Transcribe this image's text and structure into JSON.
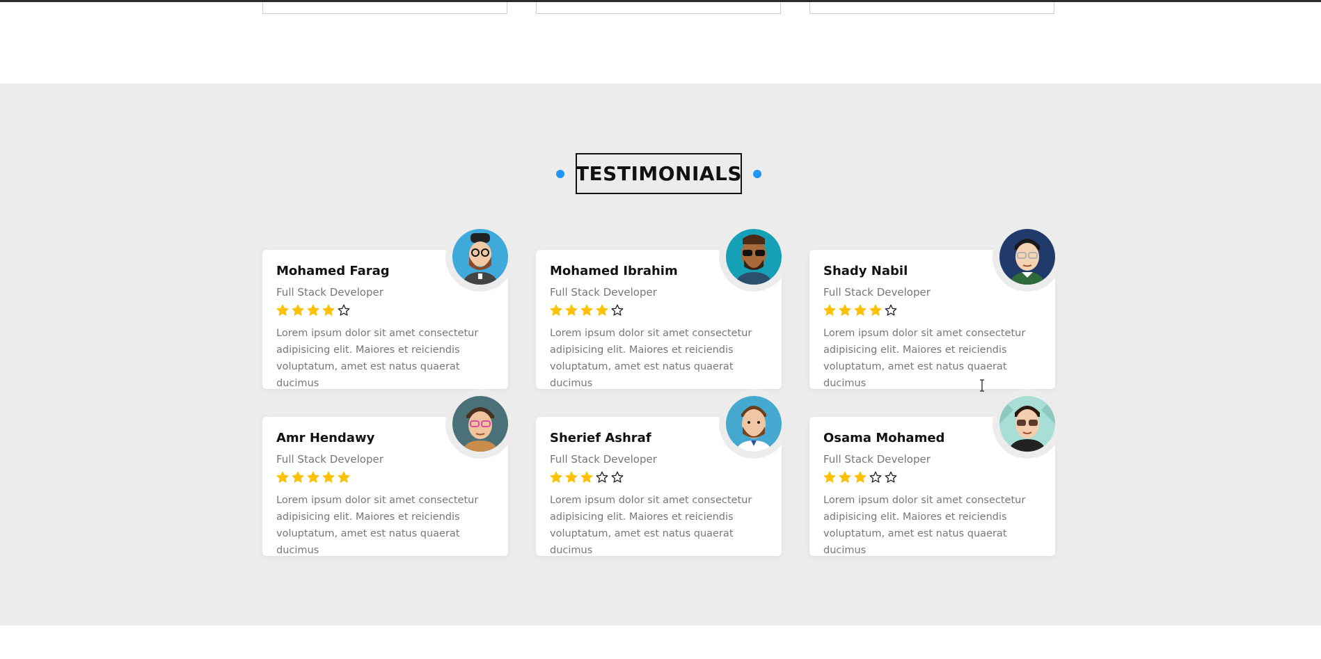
{
  "section": {
    "title": "TESTIMONIALS"
  },
  "colors": {
    "accent": "#2196f3",
    "star": "#ffc107",
    "section_bg": "#ececec"
  },
  "testimonials": [
    {
      "name": "Mohamed Farag",
      "role": "Full Stack Developer",
      "rating": 4,
      "text": "Lorem ipsum dolor sit amet consectetur adipisicing elit. Maiores et reiciendis voluptatum, amet est natus quaerat ducimus",
      "avatar": "avatar-bearded-glasses-icon"
    },
    {
      "name": "Mohamed Ibrahim",
      "role": "Full Stack Developer",
      "rating": 4,
      "text": "Lorem ipsum dolor sit amet consectetur adipisicing elit. Maiores et reiciendis voluptatum, amet est natus quaerat ducimus",
      "avatar": "avatar-sunglasses-beard-icon"
    },
    {
      "name": "Shady Nabil",
      "role": "Full Stack Developer",
      "rating": 4,
      "text": "Lorem ipsum dolor sit amet consectetur adipisicing elit. Maiores et reiciendis voluptatum, amet est natus quaerat ducimus",
      "avatar": "avatar-glasses-icon"
    },
    {
      "name": "Amr Hendawy",
      "role": "Full Stack Developer",
      "rating": 5,
      "text": "Lorem ipsum dolor sit amet consectetur adipisicing elit. Maiores et reiciendis voluptatum, amet est natus quaerat ducimus",
      "avatar": "avatar-pink-glasses-icon"
    },
    {
      "name": "Sherief Ashraf",
      "role": "Full Stack Developer",
      "rating": 3,
      "text": "Lorem ipsum dolor sit amet consectetur adipisicing elit. Maiores et reiciendis voluptatum, amet est natus quaerat ducimus",
      "avatar": "avatar-beard-icon"
    },
    {
      "name": "Osama Mohamed",
      "role": "Full Stack Developer",
      "rating": 3,
      "text": "Lorem ipsum dolor sit amet consectetur adipisicing elit. Maiores et reiciendis voluptatum, amet est natus quaerat ducimus",
      "avatar": "avatar-sunglasses-icon"
    }
  ]
}
